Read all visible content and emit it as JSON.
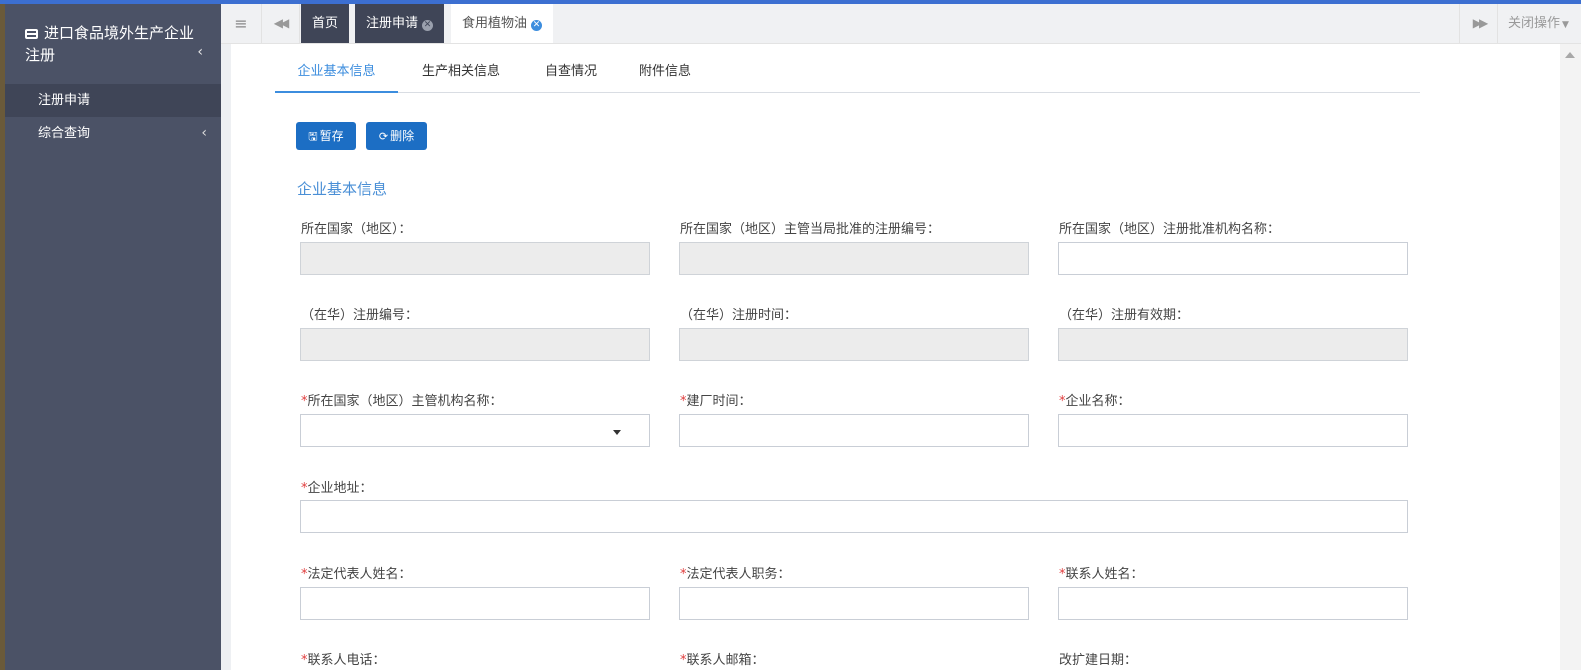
{
  "sidebar": {
    "title": "进口食品境外生产企业注册",
    "items": [
      {
        "label": "注册申请",
        "active": true
      },
      {
        "label": "综合查询",
        "active": false
      }
    ]
  },
  "tabbar": {
    "tabs": [
      {
        "label": "首页",
        "closable": false
      },
      {
        "label": "注册申请",
        "closable": true
      },
      {
        "label": "食用植物油",
        "closable": true
      }
    ],
    "close_ops": "关闭操作"
  },
  "subtabs": [
    "企业基本信息",
    "生产相关信息",
    "自查情况",
    "附件信息"
  ],
  "buttons": {
    "save": "暂存",
    "delete": "删除"
  },
  "section_title": "企业基本信息",
  "fields": {
    "country": {
      "label": "所在国家（地区）：",
      "required": false,
      "value": ""
    },
    "country_reg_no": {
      "label": "所在国家（地区）主管当局批准的注册编号：",
      "required": false,
      "value": ""
    },
    "country_reg_org": {
      "label": "所在国家（地区）注册批准机构名称：",
      "required": false,
      "value": ""
    },
    "cn_reg_no": {
      "label": "（在华）注册编号：",
      "required": false,
      "value": ""
    },
    "cn_reg_time": {
      "label": "（在华）注册时间：",
      "required": false,
      "value": ""
    },
    "cn_reg_valid": {
      "label": "（在华）注册有效期：",
      "required": false,
      "value": ""
    },
    "authority_name": {
      "label": "所在国家（地区）主管机构名称：",
      "required": true,
      "value": ""
    },
    "build_time": {
      "label": "建厂时间：",
      "required": true,
      "value": ""
    },
    "company_name": {
      "label": "企业名称：",
      "required": true,
      "value": ""
    },
    "company_address": {
      "label": "企业地址：",
      "required": true,
      "value": ""
    },
    "legal_rep_name": {
      "label": "法定代表人姓名：",
      "required": true,
      "value": ""
    },
    "legal_rep_title": {
      "label": "法定代表人职务：",
      "required": true,
      "value": ""
    },
    "contact_name": {
      "label": "联系人姓名：",
      "required": true,
      "value": ""
    },
    "contact_phone": {
      "label": "联系人电话：",
      "required": true
    },
    "contact_email": {
      "label": "联系人邮箱：",
      "required": true
    },
    "expansion_date": {
      "label": "改扩建日期：",
      "required": false
    }
  },
  "required_mark": "*",
  "icons": {
    "brand": "card-icon",
    "hamburger": "hamburger-icon",
    "prev": "backward-icon",
    "next": "forward-icon",
    "tab_close": "close-circle-icon",
    "save": "floppy-icon",
    "delete": "refresh-icon"
  },
  "colors": {
    "sidebar_bg": "#4b5266",
    "accent": "#3c8dde",
    "button_bg": "#1c6ec4",
    "required": "#e03c3c"
  }
}
